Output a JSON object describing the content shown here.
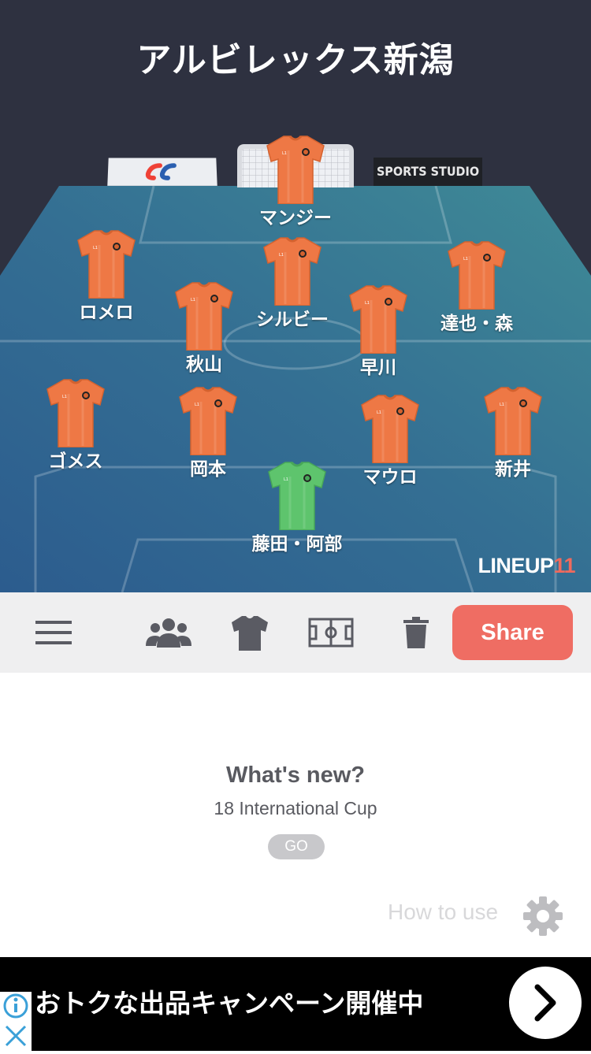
{
  "team": {
    "title": "アルビレックス新潟"
  },
  "boards": {
    "studio_label": "SPORTS STUDIO"
  },
  "brand": {
    "text": "LINEUP",
    "number": "11"
  },
  "players": [
    {
      "name": "マンジー",
      "kit": "orange"
    },
    {
      "name": "ロメロ",
      "kit": "orange"
    },
    {
      "name": "シルビー",
      "kit": "orange"
    },
    {
      "name": "達也・森",
      "kit": "orange"
    },
    {
      "name": "秋山",
      "kit": "orange"
    },
    {
      "name": "早川",
      "kit": "orange"
    },
    {
      "name": "ゴメス",
      "kit": "orange"
    },
    {
      "name": "岡本",
      "kit": "orange"
    },
    {
      "name": "マウロ",
      "kit": "orange"
    },
    {
      "name": "新井",
      "kit": "orange"
    },
    {
      "name": "藤田・阿部",
      "kit": "green"
    }
  ],
  "toolbar": {
    "icons": [
      "menu-icon",
      "players-icon",
      "shirt-icon",
      "pitch-icon",
      "trash-icon"
    ],
    "share_label": "Share"
  },
  "news": {
    "title": "What's new?",
    "subtitle": "18 International Cup",
    "go_label": "GO"
  },
  "help": {
    "how_to_use": "How to use"
  },
  "ad": {
    "text": "おトクな出品キャンペーン開催中"
  },
  "colors": {
    "header_bg": "#2e3140",
    "kit_orange": "#ee7845",
    "kit_green": "#5ec46d",
    "share": "#ef6d63",
    "pitch_light": "#3e7e92",
    "pitch_dark": "#2b5f8f"
  }
}
